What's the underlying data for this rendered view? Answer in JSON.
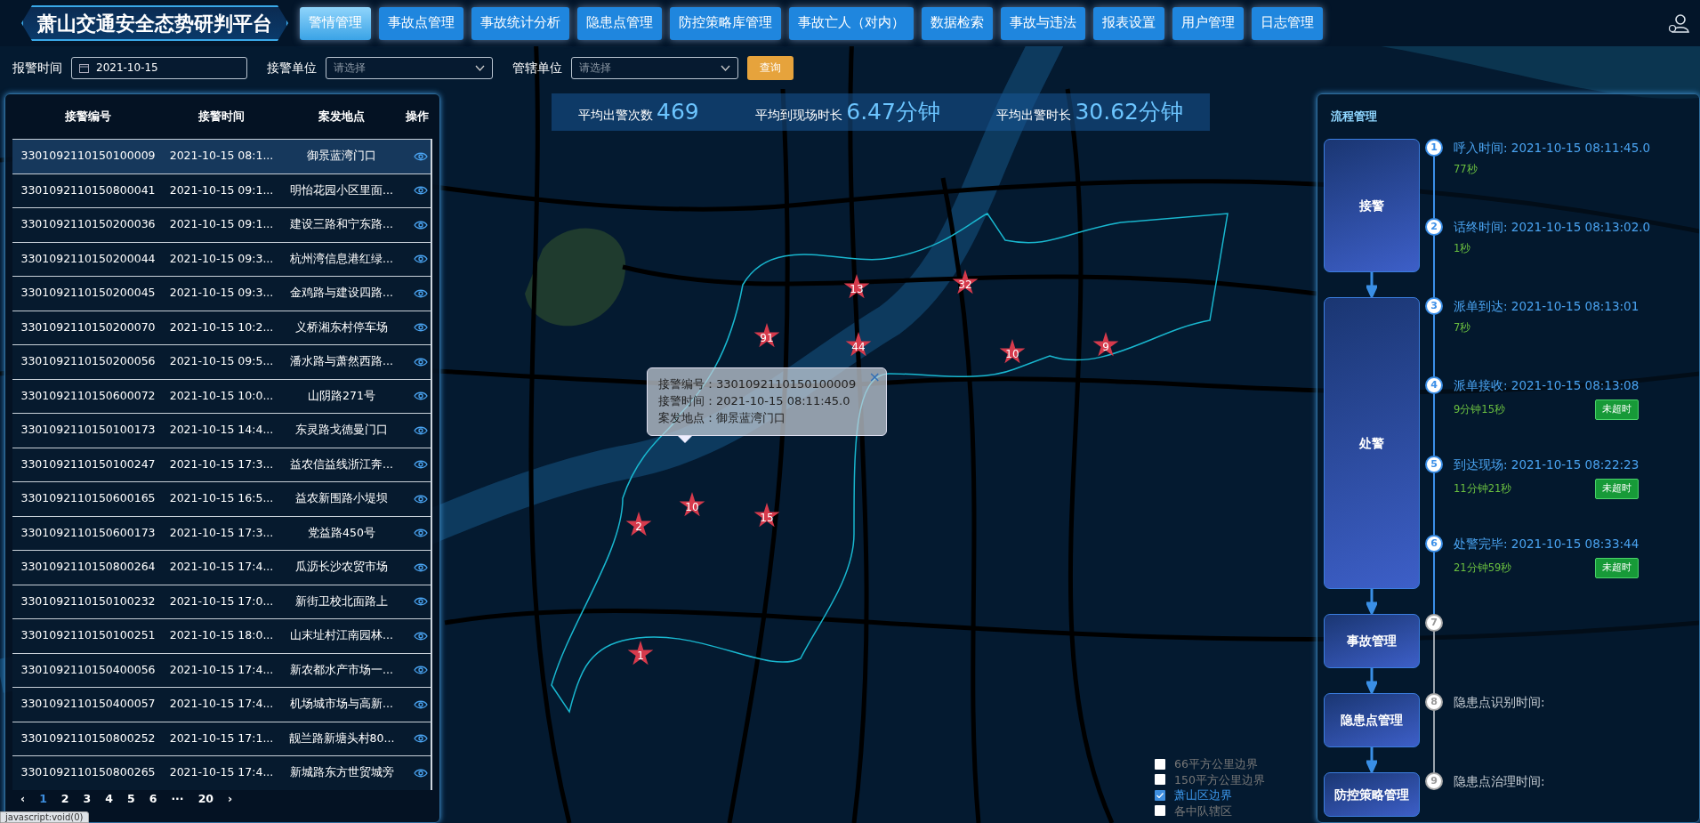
{
  "header": {
    "title": "萧山交通安全态势研判平台",
    "nav": [
      {
        "label": "警情管理",
        "selected": true
      },
      {
        "label": "事故点管理",
        "selected": false
      },
      {
        "label": "事故统计分析",
        "selected": false
      },
      {
        "label": "隐患点管理",
        "selected": false
      },
      {
        "label": "防控策略库管理",
        "selected": false
      },
      {
        "label": "事故亡人（对内）",
        "selected": false
      },
      {
        "label": "数据检索",
        "selected": false
      },
      {
        "label": "事故与违法",
        "selected": false
      },
      {
        "label": "报表设置",
        "selected": false
      },
      {
        "label": "用户管理",
        "selected": false
      },
      {
        "label": "日志管理",
        "selected": false
      }
    ]
  },
  "filters": [
    {
      "kind": "date",
      "label": "报警时间",
      "value": "2021-10-15"
    },
    {
      "kind": "select",
      "label": "接警单位",
      "placeholder": "请选择"
    },
    {
      "kind": "select",
      "label": "管辖单位",
      "placeholder": "请选择"
    }
  ],
  "query_button": "查询",
  "alarm_table": {
    "columns": [
      "接警编号",
      "接警时间",
      "案发地点",
      "操作"
    ],
    "rows": [
      {
        "id": "3301092110150100009",
        "time": "2021-10-15 08:1...",
        "place": "御景蓝湾门口",
        "selected": true
      },
      {
        "id": "3301092110150800041",
        "time": "2021-10-15 09:1...",
        "place": "明怡花园小区里面...",
        "selected": false
      },
      {
        "id": "3301092110150200036",
        "time": "2021-10-15 09:1...",
        "place": "建设三路和宁东路...",
        "selected": false
      },
      {
        "id": "3301092110150200044",
        "time": "2021-10-15 09:3...",
        "place": "杭州湾信息港红绿...",
        "selected": false
      },
      {
        "id": "3301092110150200045",
        "time": "2021-10-15 09:3...",
        "place": "金鸡路与建设四路...",
        "selected": false
      },
      {
        "id": "3301092110150200070",
        "time": "2021-10-15 10:2...",
        "place": "义桥湘东村停车场",
        "selected": false
      },
      {
        "id": "3301092110150200056",
        "time": "2021-10-15 09:5...",
        "place": "潘水路与萧然西路...",
        "selected": false
      },
      {
        "id": "3301092110150600072",
        "time": "2021-10-15 10:0...",
        "place": "山阴路271号",
        "selected": false
      },
      {
        "id": "3301092110150100173",
        "time": "2021-10-15 14:4...",
        "place": "东灵路戈德曼门口",
        "selected": false
      },
      {
        "id": "3301092110150100247",
        "time": "2021-10-15 17:3...",
        "place": "益农信益线浙江奔...",
        "selected": false
      },
      {
        "id": "3301092110150600165",
        "time": "2021-10-15 16:5...",
        "place": "益农新围路小堤坝",
        "selected": false
      },
      {
        "id": "3301092110150600173",
        "time": "2021-10-15 17:3...",
        "place": "党益路450号",
        "selected": false
      },
      {
        "id": "3301092110150800264",
        "time": "2021-10-15 17:4...",
        "place": "瓜沥长沙农贸市场",
        "selected": false
      },
      {
        "id": "3301092110150100232",
        "time": "2021-10-15 17:0...",
        "place": "新街卫校北面路上",
        "selected": false
      },
      {
        "id": "3301092110150100251",
        "time": "2021-10-15 18:0...",
        "place": "山末址村江南园林...",
        "selected": false
      },
      {
        "id": "3301092110150400056",
        "time": "2021-10-15 17:4...",
        "place": "新农都水产市场一...",
        "selected": false
      },
      {
        "id": "3301092110150400057",
        "time": "2021-10-15 17:4...",
        "place": "机场城市场与高新...",
        "selected": false
      },
      {
        "id": "3301092110150800252",
        "time": "2021-10-15 17:1...",
        "place": "靓兰路新塘头村80...",
        "selected": false
      },
      {
        "id": "3301092110150800265",
        "time": "2021-10-15 17:4...",
        "place": "新城路东方世贸城旁",
        "selected": false
      }
    ],
    "prev": "‹",
    "next": "›",
    "pages": [
      {
        "label": "1",
        "selected": true
      },
      {
        "label": "2",
        "selected": false
      },
      {
        "label": "3",
        "selected": false
      },
      {
        "label": "4",
        "selected": false
      },
      {
        "label": "5",
        "selected": false
      },
      {
        "label": "6",
        "selected": false
      },
      {
        "label": "···",
        "selected": false
      },
      {
        "label": "20",
        "selected": false
      }
    ]
  },
  "stats": [
    {
      "label": "平均出警次数",
      "value": "469"
    },
    {
      "label": "平均到现场时长",
      "value": "6.47分钟"
    },
    {
      "label": "平均出警时长",
      "value": "30.62分钟"
    }
  ],
  "map": {
    "markers": [
      {
        "count": "13"
      },
      {
        "count": "32"
      },
      {
        "count": "91"
      },
      {
        "count": "44"
      },
      {
        "count": "10"
      },
      {
        "count": "9"
      },
      {
        "count": "10"
      },
      {
        "count": "15"
      },
      {
        "count": "2"
      },
      {
        "count": "1"
      }
    ],
    "popup": {
      "close": "×",
      "lines": [
        "接警编号：3301092110150100009",
        "接警时间：2021-10-15 08:11:45.0",
        "案发地点：御景蓝湾门口"
      ]
    },
    "legend": [
      {
        "label": "66平方公里边界",
        "checked": false
      },
      {
        "label": "150平方公里边界",
        "checked": false
      },
      {
        "label": "萧山区边界",
        "checked": true
      },
      {
        "label": "各中队辖区",
        "checked": false
      }
    ]
  },
  "process": {
    "title": "流程管理",
    "stages": [
      {
        "label": "接警",
        "steps": [
          {
            "number": "1",
            "text": "呼入时间: 2021-10-15 08:11:45.0",
            "duration": "77秒",
            "done": true
          },
          {
            "number": "2",
            "text": "话终时间: 2021-10-15 08:13:02.0",
            "duration": "1秒",
            "done": true
          }
        ]
      },
      {
        "label": "处警",
        "steps": [
          {
            "number": "3",
            "text": "派单到达: 2021-10-15 08:13:01",
            "duration": "7秒",
            "done": true
          },
          {
            "number": "4",
            "text": "派单接收: 2021-10-15 08:13:08",
            "duration": "9分钟15秒",
            "badge": "未超时",
            "done": true
          },
          {
            "number": "5",
            "text": "到达现场: 2021-10-15 08:22:23",
            "duration": "11分钟21秒",
            "badge": "未超时",
            "done": true
          },
          {
            "number": "6",
            "text": "处警完毕: 2021-10-15 08:33:44",
            "duration": "21分钟59秒",
            "badge": "未超时",
            "done": true
          }
        ]
      },
      {
        "label": "事故管理",
        "steps": [
          {
            "number": "7",
            "done": false
          }
        ]
      },
      {
        "label": "隐患点管理",
        "steps": [
          {
            "number": "8",
            "text": "隐患点识别时间:",
            "done": false
          }
        ]
      },
      {
        "label": "防控策略管理",
        "steps": [
          {
            "number": "9",
            "text": "隐患点治理时间:",
            "done": false
          }
        ]
      }
    ]
  },
  "status_url": "javascript:void(0)"
}
